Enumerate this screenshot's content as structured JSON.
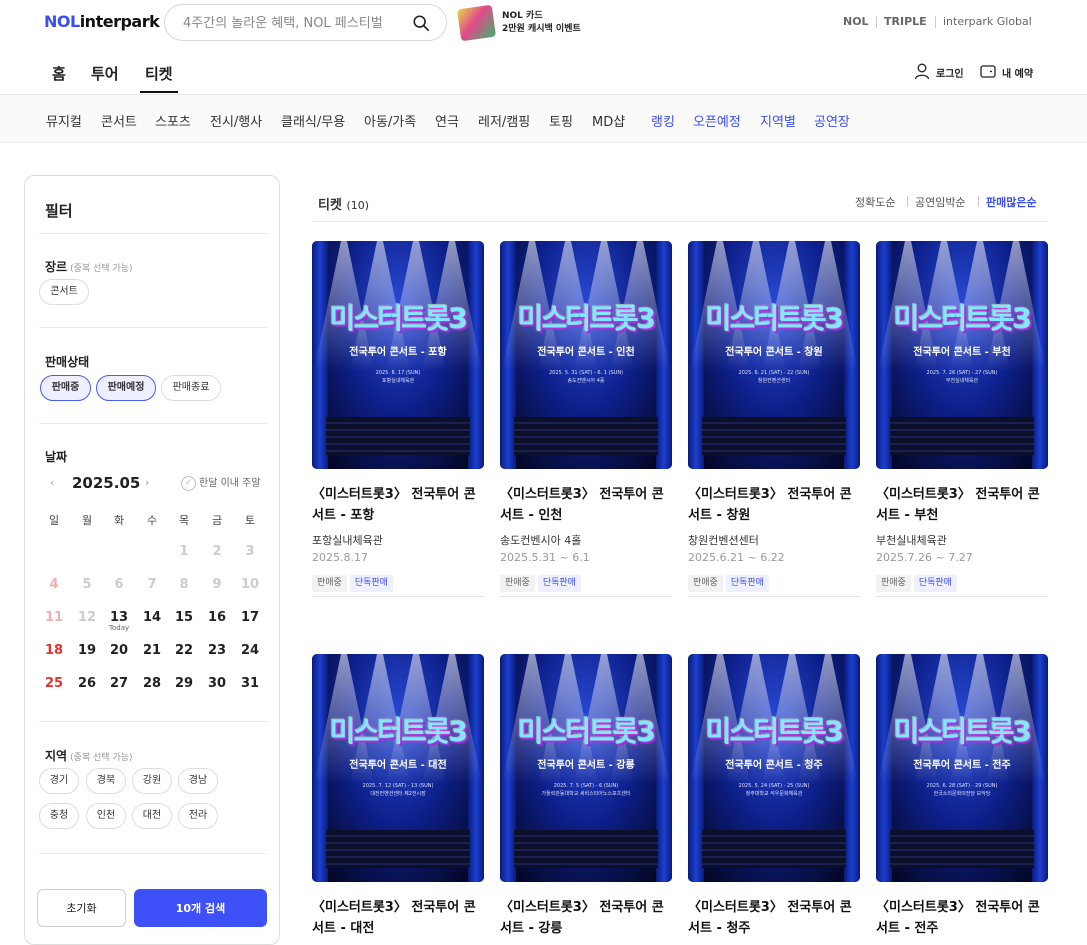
{
  "header": {
    "logo_nol": "NOL",
    "logo_interpark": "interpark",
    "search_placeholder": "4주간의 놀라운 혜택, NOL 페스티벌",
    "promo_line1": "NOL 카드",
    "promo_line2": "2만원 캐시백 이벤트",
    "partners": [
      "NOL",
      "TRIPLE",
      "interpark Global"
    ]
  },
  "main_nav": {
    "tabs": [
      "홈",
      "투어",
      "티켓"
    ],
    "active_tab": "티켓",
    "login": "로그인",
    "my_booking": "내 예약"
  },
  "category_nav": {
    "items": [
      "뮤지컬",
      "콘서트",
      "스포츠",
      "전시/행사",
      "클래식/무용",
      "아동/가족",
      "연극",
      "레저/캠핑",
      "토핑",
      "MD샵"
    ],
    "special": [
      "랭킹",
      "오픈예정",
      "지역별",
      "공연장"
    ]
  },
  "filter": {
    "title": "필터",
    "genre_label": "장르",
    "genre_hint": "(중복 선택 가능)",
    "genre_chips": [
      "콘서트"
    ],
    "status_label": "판매상태",
    "status_chips": [
      {
        "label": "판매중",
        "selected": true
      },
      {
        "label": "판매예정",
        "selected": true
      },
      {
        "label": "판매종료",
        "selected": false
      }
    ],
    "date_label": "날짜",
    "month": "2025.05",
    "prev_arrow": "‹",
    "next_arrow": "›",
    "weekend_toggle": "한달 이내 주말",
    "weekdays": [
      "일",
      "월",
      "화",
      "수",
      "목",
      "금",
      "토"
    ],
    "today_day": "13",
    "today_label": "Today",
    "region_label": "지역",
    "region_hint": "(중복 선택 가능)",
    "region_chips": [
      "경기",
      "경북",
      "강원",
      "경남",
      "충청",
      "인천",
      "대전",
      "전라"
    ],
    "reset_button": "초기화",
    "search_button": "10개 검색"
  },
  "results": {
    "title": "티켓",
    "count": "(10)",
    "sort_options": [
      "정확도순",
      "공연임박순",
      "판매많은순"
    ],
    "active_sort": "판매많은순",
    "cards": [
      {
        "title": "〈미스터트롯3〉 전국투어 콘서트 - 포항",
        "venue": "포항실내체육관",
        "date": "2025.8.17",
        "status": "판매중",
        "exclusive": "단독판매",
        "poster_title": "미스터트롯3",
        "poster_sub": "전국투어 콘서트 - 포항",
        "poster_date": "2025. 8. 17 (SUN)",
        "poster_venue": "포항실내체육관"
      },
      {
        "title": "〈미스터트롯3〉 전국투어 콘서트 - 인천",
        "venue": "송도컨벤시아 4홀",
        "date": "2025.5.31 ~ 6.1",
        "status": "판매중",
        "exclusive": "단독판매",
        "poster_title": "미스터트롯3",
        "poster_sub": "전국투어 콘서트 - 인천",
        "poster_date": "2025. 5. 31 (SAT) - 6. 1 (SUN)",
        "poster_venue": "송도컨벤시아 4홀"
      },
      {
        "title": "〈미스터트롯3〉 전국투어 콘서트 - 창원",
        "venue": "창원컨벤션센터",
        "date": "2025.6.21 ~ 6.22",
        "status": "판매중",
        "exclusive": "단독판매",
        "poster_title": "미스터트롯3",
        "poster_sub": "전국투어 콘서트 - 창원",
        "poster_date": "2025. 6. 21 (SAT) - 22 (SUN)",
        "poster_venue": "창원컨벤션센터"
      },
      {
        "title": "〈미스터트롯3〉 전국투어 콘서트 - 부천",
        "venue": "부천실내체육관",
        "date": "2025.7.26 ~ 7.27",
        "status": "판매중",
        "exclusive": "단독판매",
        "poster_title": "미스터트롯3",
        "poster_sub": "전국투어 콘서트 - 부천",
        "poster_date": "2025. 7. 26 (SAT) - 27 (SUN)",
        "poster_venue": "부천실내체육관"
      },
      {
        "title": "〈미스터트롯3〉 전국투어 콘서트 - 대전",
        "venue": "",
        "date": "",
        "status": "",
        "exclusive": "",
        "poster_title": "미스터트롯3",
        "poster_sub": "전국투어 콘서트 - 대전",
        "poster_date": "2025. 7. 12 (SAT) - 13 (SUN)",
        "poster_venue": "대전컨벤션센터 제2전시장"
      },
      {
        "title": "〈미스터트롯3〉 전국투어 콘서트 - 강릉",
        "venue": "",
        "date": "",
        "status": "",
        "exclusive": "",
        "poster_title": "미스터트롯3",
        "poster_sub": "전국투어 콘서트 - 강릉",
        "poster_date": "2025. 7. 5 (SAT) - 6 (SUN)",
        "poster_venue": "가톨릭관동대학교 세비스티아노스포츠센터"
      },
      {
        "title": "〈미스터트롯3〉 전국투어 콘서트 - 청주",
        "venue": "",
        "date": "",
        "status": "",
        "exclusive": "",
        "poster_title": "미스터트롯3",
        "poster_sub": "전국투어 콘서트 - 청주",
        "poster_date": "2025. 5. 24 (SAT) - 25 (SUN)",
        "poster_venue": "청주대학교 석우문화체육관"
      },
      {
        "title": "〈미스터트롯3〉 전국투어 콘서트 - 전주",
        "venue": "",
        "date": "",
        "status": "",
        "exclusive": "",
        "poster_title": "미스터트롯3",
        "poster_sub": "전국투어 콘서트 - 전주",
        "poster_date": "2025. 6. 28 (SAT) - 29 (SUN)",
        "poster_venue": "한국소리문화의전당 모악당"
      }
    ]
  },
  "colors": {
    "accent": "#3e50f7",
    "sunday": "#e8322e",
    "poster_blue": "#0d1f8a"
  }
}
